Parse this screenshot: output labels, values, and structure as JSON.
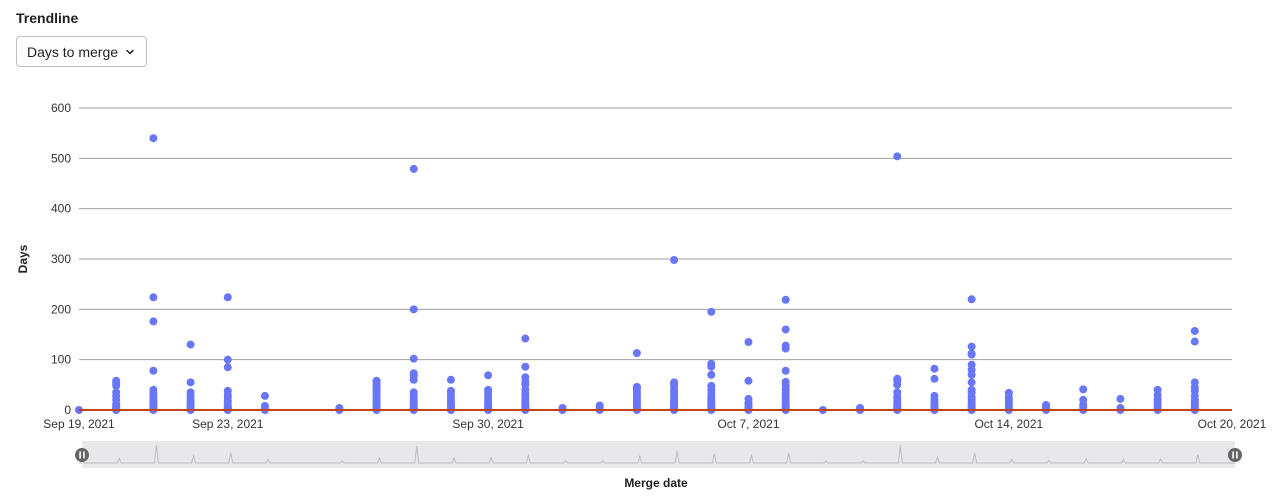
{
  "header": {
    "title": "Trendline"
  },
  "dropdown": {
    "selected": "Days to merge",
    "icon": "chevron-down-icon"
  },
  "colors": {
    "points": "#6977f7",
    "trendline": "#c0451b",
    "slider_fill": "#e8e8ea",
    "slider_line": "#bdbdc3",
    "handle": "#666666",
    "grid": "#a0a0a0"
  },
  "chart_data": {
    "type": "scatter",
    "xlabel": "Merge date",
    "ylabel": "Days",
    "ylim": [
      0,
      600
    ],
    "xlim": [
      "2021-09-19",
      "2021-10-20"
    ],
    "y_ticks": [
      "0",
      "100",
      "200",
      "300",
      "400",
      "500",
      "600"
    ],
    "x_ticks": [
      {
        "date": "2021-09-19",
        "label": "Sep 19, 2021"
      },
      {
        "date": "2021-09-23",
        "label": "Sep 23, 2021"
      },
      {
        "date": "2021-09-30",
        "label": "Sep 30, 2021"
      },
      {
        "date": "2021-10-07",
        "label": "Oct 7, 2021"
      },
      {
        "date": "2021-10-14",
        "label": "Oct 14, 2021"
      },
      {
        "date": "2021-10-20",
        "label": "Oct 20, 2021"
      }
    ],
    "grid": true,
    "trendline": {
      "y": 0
    },
    "series": [
      {
        "points": [
          {
            "x": "2021-09-19",
            "y": [
              0
            ]
          },
          {
            "x": "2021-09-20",
            "y": [
              0,
              1,
              2,
              3,
              5,
              8,
              12,
              20,
              28,
              35,
              48,
              53,
              58
            ]
          },
          {
            "x": "2021-09-21",
            "y": [
              0,
              1,
              2,
              3,
              4,
              6,
              8,
              10,
              14,
              18,
              22,
              27,
              33,
              40,
              78,
              176,
              224,
              540
            ]
          },
          {
            "x": "2021-09-22",
            "y": [
              0,
              1,
              2,
              4,
              6,
              10,
              15,
              20,
              28,
              35,
              55,
              130
            ]
          },
          {
            "x": "2021-09-23",
            "y": [
              0,
              1,
              2,
              3,
              5,
              8,
              12,
              18,
              25,
              30,
              38,
              85,
              100,
              224
            ]
          },
          {
            "x": "2021-09-24",
            "y": [
              0,
              3,
              8,
              28
            ]
          },
          {
            "x": "2021-09-26",
            "y": [
              0,
              4
            ]
          },
          {
            "x": "2021-09-27",
            "y": [
              0,
              1,
              2,
              3,
              5,
              8,
              12,
              16,
              20,
              25,
              30,
              35,
              40,
              45,
              50,
              56,
              58
            ]
          },
          {
            "x": "2021-09-28",
            "y": [
              0,
              1,
              2,
              3,
              5,
              8,
              12,
              16,
              20,
              28,
              35,
              60,
              68,
              73,
              102,
              200,
              479
            ]
          },
          {
            "x": "2021-09-29",
            "y": [
              0,
              1,
              2,
              4,
              6,
              10,
              14,
              20,
              26,
              32,
              38,
              60
            ]
          },
          {
            "x": "2021-09-30",
            "y": [
              0,
              1,
              2,
              4,
              6,
              10,
              14,
              20,
              26,
              34,
              40,
              69
            ]
          },
          {
            "x": "2021-10-01",
            "y": [
              0,
              1,
              2,
              4,
              6,
              10,
              14,
              20,
              26,
              32,
              40,
              50,
              56,
              65,
              86,
              142
            ]
          },
          {
            "x": "2021-10-02",
            "y": [
              0,
              4
            ]
          },
          {
            "x": "2021-10-03",
            "y": [
              0,
              5,
              9
            ]
          },
          {
            "x": "2021-10-04",
            "y": [
              0,
              1,
              3,
              5,
              8,
              12,
              16,
              20,
              25,
              30,
              35,
              40,
              44,
              46,
              113
            ]
          },
          {
            "x": "2021-10-05",
            "y": [
              0,
              1,
              3,
              5,
              8,
              12,
              16,
              20,
              25,
              30,
              35,
              40,
              48,
              52,
              55,
              298
            ]
          },
          {
            "x": "2021-10-06",
            "y": [
              0,
              1,
              2,
              4,
              6,
              10,
              14,
              20,
              26,
              32,
              40,
              48,
              70,
              86,
              92,
              195
            ]
          },
          {
            "x": "2021-10-07",
            "y": [
              0,
              2,
              5,
              10,
              15,
              22,
              58,
              135
            ]
          },
          {
            "x": "2021-10-08",
            "y": [
              0,
              1,
              2,
              4,
              6,
              10,
              14,
              20,
              26,
              32,
              40,
              48,
              56,
              78,
              122,
              128,
              160,
              219
            ]
          },
          {
            "x": "2021-10-09",
            "y": [
              0
            ]
          },
          {
            "x": "2021-10-10",
            "y": [
              0,
              4
            ]
          },
          {
            "x": "2021-10-11",
            "y": [
              0,
              1,
              2,
              4,
              6,
              10,
              14,
              20,
              26,
              35,
              50,
              58,
              62,
              504
            ]
          },
          {
            "x": "2021-10-12",
            "y": [
              0,
              1,
              2,
              4,
              6,
              10,
              14,
              20,
              28,
              62,
              82
            ]
          },
          {
            "x": "2021-10-13",
            "y": [
              0,
              1,
              2,
              4,
              6,
              10,
              14,
              20,
              26,
              34,
              40,
              55,
              70,
              80,
              90,
              110,
              112,
              126,
              220
            ]
          },
          {
            "x": "2021-10-14",
            "y": [
              0,
              2,
              5,
              10,
              15,
              20,
              25,
              34
            ]
          },
          {
            "x": "2021-10-15",
            "y": [
              0,
              3,
              6,
              10
            ]
          },
          {
            "x": "2021-10-16",
            "y": [
              0,
              5,
              10,
              20,
              41
            ]
          },
          {
            "x": "2021-10-17",
            "y": [
              0,
              4,
              22
            ]
          },
          {
            "x": "2021-10-18",
            "y": [
              0,
              2,
              6,
              10,
              16,
              22,
              30,
              40
            ]
          },
          {
            "x": "2021-10-19",
            "y": [
              0,
              1,
              2,
              4,
              6,
              8,
              12,
              16,
              20,
              28,
              38,
              45,
              55,
              136,
              157
            ]
          }
        ]
      }
    ]
  }
}
